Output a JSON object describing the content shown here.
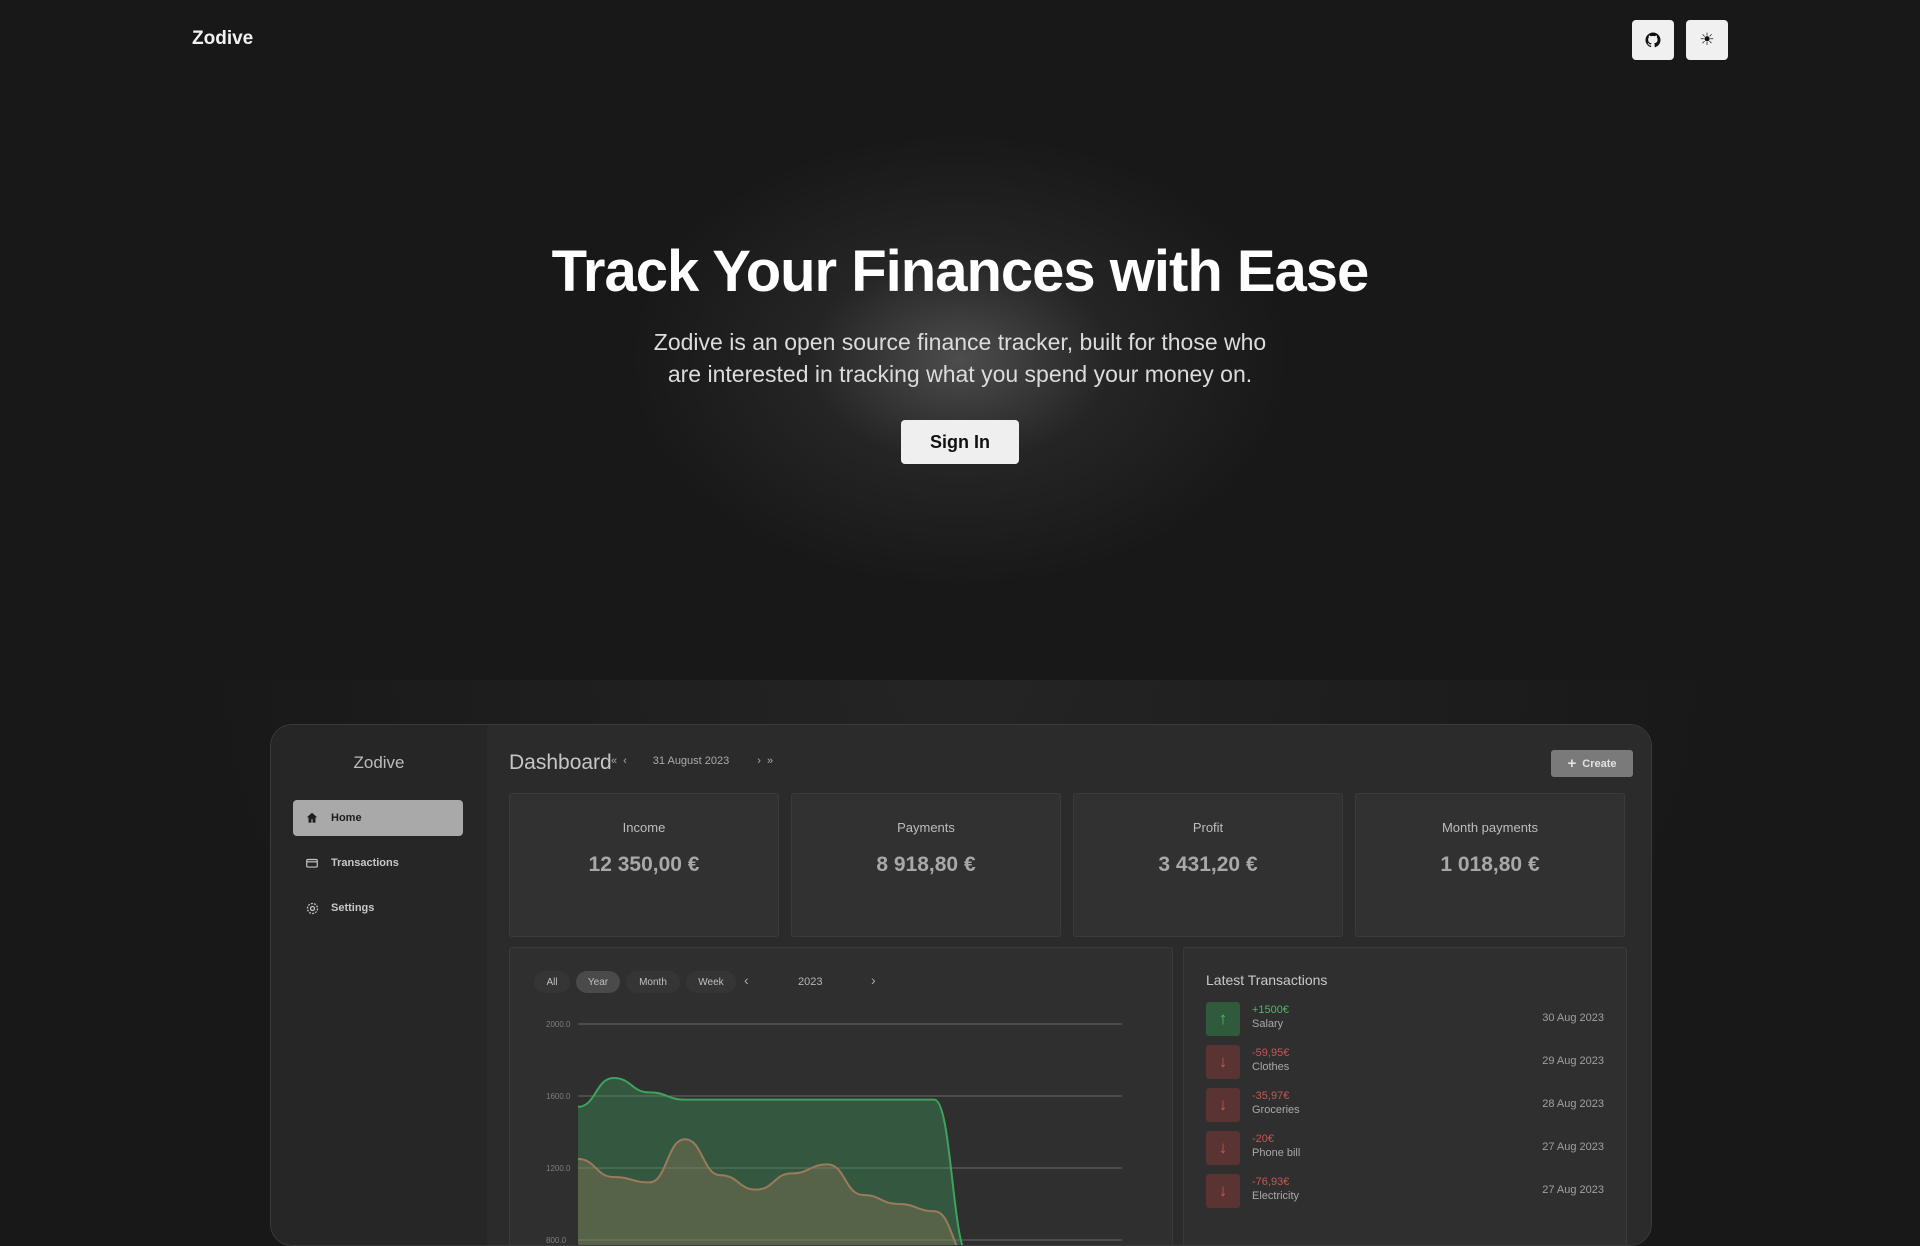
{
  "header": {
    "brand": "Zodive",
    "github_icon": "github-icon",
    "theme_icon": "sun-icon"
  },
  "hero": {
    "title": "Track Your Finances with Ease",
    "subtitle": "Zodive is an open source finance tracker, built for those who are interested in tracking what you spend your money on.",
    "signin_label": "Sign In"
  },
  "app": {
    "logo": "Zodive",
    "nav": [
      {
        "label": "Home",
        "icon": "home-icon",
        "active": true
      },
      {
        "label": "Transactions",
        "icon": "wallet-icon",
        "active": false
      },
      {
        "label": "Settings",
        "icon": "gear-icon",
        "active": false
      }
    ],
    "dashboard_title": "Dashboard",
    "date": "31 August 2023",
    "create_label": "Create",
    "stats": [
      {
        "label": "Income",
        "value": "12 350,00 €"
      },
      {
        "label": "Payments",
        "value": "8 918,80 €"
      },
      {
        "label": "Profit",
        "value": "3 431,20 €"
      },
      {
        "label": "Month payments",
        "value": "1 018,80 €"
      }
    ],
    "periods": [
      "All",
      "Year",
      "Month",
      "Week"
    ],
    "active_period": "Year",
    "year": "2023",
    "latest_title": "Latest Transactions",
    "transactions": [
      {
        "amount": "+1500€",
        "name": "Salary",
        "date": "30 Aug 2023",
        "type": "income"
      },
      {
        "amount": "-59,95€",
        "name": "Clothes",
        "date": "29 Aug 2023",
        "type": "expense"
      },
      {
        "amount": "-35,97€",
        "name": "Groceries",
        "date": "28 Aug 2023",
        "type": "expense"
      },
      {
        "amount": "-20€",
        "name": "Phone bill",
        "date": "27 Aug 2023",
        "type": "expense"
      },
      {
        "amount": "-76,93€",
        "name": "Electricity",
        "date": "27 Aug 2023",
        "type": "expense"
      }
    ]
  },
  "chart_data": {
    "type": "area",
    "yticks": [
      "2000.0",
      "1600.0",
      "1200.0",
      "800.0"
    ],
    "ylim": [
      700,
      2000
    ],
    "series": [
      {
        "color": "#3fa35e",
        "values": [
          1540,
          1700,
          1620,
          1580,
          1580,
          1580,
          1580,
          1580,
          1580,
          1580,
          1580,
          700
        ]
      },
      {
        "color": "#9c7a5c",
        "values": [
          1250,
          1150,
          1120,
          1360,
          1160,
          1080,
          1170,
          1220,
          1050,
          1000,
          960,
          700
        ]
      }
    ],
    "colors": {
      "income_green": "#4fb56a",
      "expense_red": "#c65757"
    }
  }
}
